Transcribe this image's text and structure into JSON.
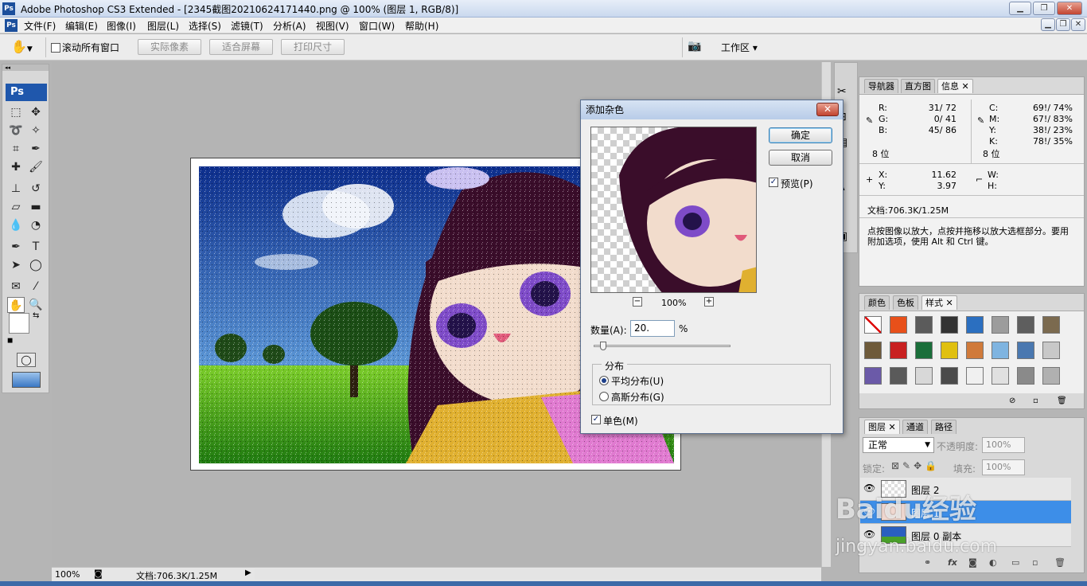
{
  "window": {
    "app_icon": "Ps",
    "title": "Adobe Photoshop CS3 Extended - [2345截图20210624171440.png @ 100% (图层 1, RGB/8)]",
    "controls": [
      "▁",
      "❐",
      "✕"
    ]
  },
  "menubar": {
    "app_icon": "Ps",
    "items": [
      "文件(F)",
      "编辑(E)",
      "图像(I)",
      "图层(L)",
      "选择(S)",
      "滤镜(T)",
      "分析(A)",
      "视图(V)",
      "窗口(W)",
      "帮助(H)"
    ],
    "doc_controls": [
      "▁",
      "❐",
      "✕"
    ]
  },
  "options_bar": {
    "tool_icon": "hand-icon",
    "scroll_all_label": "滚动所有窗口",
    "actual_pixels": "实际像素",
    "fit_screen": "适合屏幕",
    "print_size": "打印尺寸",
    "workspace": "工作区"
  },
  "toolbox": {
    "logo": "Ps",
    "tools": [
      "marquee-icon",
      "move-icon",
      "lasso-icon",
      "magic-wand-icon",
      "crop-icon",
      "slice-icon",
      "healing-icon",
      "brush-icon",
      "stamp-icon",
      "history-brush-icon",
      "eraser-icon",
      "gradient-icon",
      "blur-icon",
      "dodge-icon",
      "pen-icon",
      "type-icon",
      "path-select-icon",
      "shape-icon",
      "notes-icon",
      "eyedropper-icon",
      "hand-icon",
      "zoom-icon"
    ]
  },
  "status": {
    "zoom": "100%",
    "doc_size": "文档:706.3K/1.25M"
  },
  "info_panel": {
    "tabs": [
      "导航器",
      "直方图",
      "信息"
    ],
    "r_label": "R:",
    "r_val": "31/  72",
    "g_label": "G:",
    "g_val": "0/  41",
    "b_label": "B:",
    "b_val": "45/  86",
    "c_label": "C:",
    "c_val": "69!/  74%",
    "m_label": "M:",
    "m_val": "67!/  83%",
    "y_label": "Y:",
    "y_val": "38!/  23%",
    "k_label": "K:",
    "k_val": "78!/  35%",
    "bits_left": "8 位",
    "bits_right": "8 位",
    "x_label": "X:",
    "x_val": "11.62",
    "ypos_label": "Y:",
    "ypos_val": "3.97",
    "w_label": "W:",
    "h_label": "H:",
    "doc": "文档:706.3K/1.25M",
    "hint": "点按图像以放大，点按并拖移以放大选框部分。要用附加选项，使用 Alt 和 Ctrl 键。"
  },
  "styles_panel": {
    "tabs": [
      "颜色",
      "色板",
      "样式"
    ],
    "swatch_colors": [
      "#ffffff",
      "#e8501a",
      "#5b5b5b",
      "#333333",
      "#2b6fc0",
      "#9c9c9c",
      "#5e5e5e",
      "#7b6a4f",
      "#6e5a3a",
      "#c82020",
      "#1a6e3a",
      "#e0c010",
      "#d07a3a",
      "#7fb4e0",
      "#4a78b0",
      "#c8c8c8",
      "#6b5aa8",
      "#5a5a5a",
      "#d8d8d8",
      "#4a4a4a",
      "#f0f0f0",
      "#e0e0e0",
      "#8a8a8a",
      "#b0b0b0"
    ]
  },
  "layers_panel": {
    "tabs": [
      "图层",
      "通道",
      "路径"
    ],
    "blend_mode": "正常",
    "opacity_label": "不透明度:",
    "opacity": "100%",
    "lock_label": "锁定:",
    "fill_label": "填充:",
    "fill": "100%",
    "layers": [
      {
        "name": "图层 2",
        "selected": false
      },
      {
        "name": "图层 1",
        "selected": true
      },
      {
        "name": "图层 0 副本",
        "selected": false
      }
    ]
  },
  "dialog": {
    "title": "添加杂色",
    "ok": "确定",
    "cancel": "取消",
    "preview_label": "预览(P)",
    "zoom": "100%",
    "amount_label": "数量(A):",
    "amount": "20.",
    "percent": "%",
    "amount_fraction": 0.2,
    "distribution_label": "分布",
    "uniform": "平均分布(U)",
    "gaussian": "高斯分布(G)",
    "mono": "单色(M)"
  },
  "watermark": {
    "text": "Baidu经验",
    "url": "jingyan.baidu.com"
  }
}
